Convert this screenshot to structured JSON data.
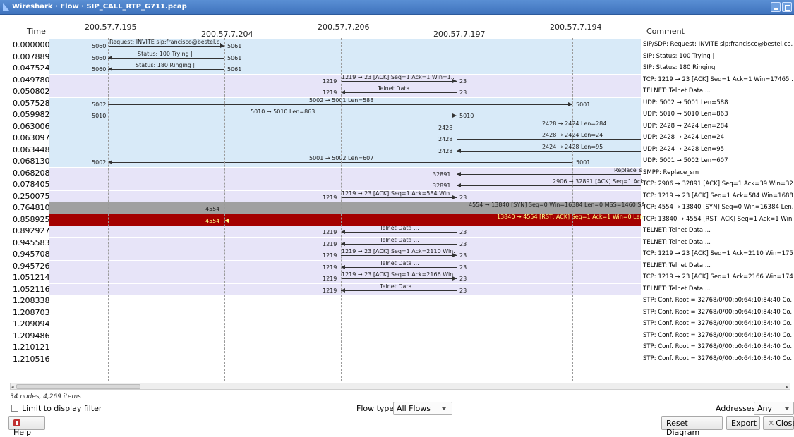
{
  "window": {
    "title": "Wireshark · Flow · SIP_CALL_RTP_G711.pcap"
  },
  "headers": {
    "time": "Time",
    "comment": "Comment"
  },
  "nodes": [
    "200.57.7.195",
    "200.57.7.204",
    "200.57.7.206",
    "200.57.7.197",
    "200.57.7.194"
  ],
  "rows": [
    {
      "time": "0.000000",
      "comment": "SIP/SDP: Request: INVITE sip:francisco@bestel.co...",
      "label": "Request: INVITE sip:francisco@bestel.c...",
      "src_port": "5060",
      "dst_port": "5061",
      "bg": "blue"
    },
    {
      "time": "0.007889",
      "comment": "SIP: Status: 100 Trying |",
      "label": "Status: 100 Trying |",
      "src_port": "5061",
      "dst_port": "5060",
      "bg": "blue"
    },
    {
      "time": "0.047524",
      "comment": "SIP: Status: 180 Ringing |",
      "label": "Status: 180 Ringing |",
      "src_port": "5061",
      "dst_port": "5060",
      "bg": "blue"
    },
    {
      "time": "0.049780",
      "comment": "TCP: 1219 → 23 [ACK] Seq=1 Ack=1 Win=17465 ...",
      "label": "1219 → 23 [ACK] Seq=1 Ack=1 Win=1...",
      "src_port": "1219",
      "dst_port": "23",
      "bg": "purple"
    },
    {
      "time": "0.050802",
      "comment": "TELNET: Telnet Data ...",
      "label": "Telnet Data ...",
      "src_port": "23",
      "dst_port": "1219",
      "bg": "purple"
    },
    {
      "time": "0.057528",
      "comment": "UDP: 5002 → 5001 Len=588",
      "label": "5002 → 5001 Len=588",
      "src_port": "5002",
      "dst_port": "5001",
      "bg": "blue"
    },
    {
      "time": "0.059982",
      "comment": "UDP: 5010 → 5010 Len=863",
      "label": "5010 → 5010 Len=863",
      "src_port": "5010",
      "dst_port": "5010",
      "bg": "blue"
    },
    {
      "time": "0.063006",
      "comment": "UDP: 2428 → 2424 Len=284",
      "label": "2428 → 2424 Len=284",
      "src_port": "2428",
      "dst_port": "",
      "bg": "blue"
    },
    {
      "time": "0.063097",
      "comment": "UDP: 2428 → 2424 Len=24",
      "label": "2428 → 2424 Len=24",
      "src_port": "2428",
      "dst_port": "",
      "bg": "blue"
    },
    {
      "time": "0.063448",
      "comment": "UDP: 2424 → 2428 Len=95",
      "label": "2424 → 2428 Len=95",
      "src_port": "",
      "dst_port": "2428",
      "bg": "blue"
    },
    {
      "time": "0.068130",
      "comment": "UDP: 5001 → 5002 Len=607",
      "label": "5001 → 5002 Len=607",
      "src_port": "5001",
      "dst_port": "5002",
      "bg": "blue"
    },
    {
      "time": "0.068208",
      "comment": "SMPP: Replace_sm",
      "label": "Replace_s",
      "src_port": "",
      "dst_port": "32891",
      "bg": "purple"
    },
    {
      "time": "0.078405",
      "comment": "TCP: 2906 → 32891 [ACK] Seq=1 Ack=39 Win=32...",
      "label": "2906 → 32891 [ACK] Seq=1 Ack",
      "src_port": "",
      "dst_port": "32891",
      "bg": "purple"
    },
    {
      "time": "0.250075",
      "comment": "TCP: 1219 → 23 [ACK] Seq=1 Ack=584 Win=1688...",
      "label": "1219 → 23 [ACK] Seq=1 Ack=584 Win...",
      "src_port": "1219",
      "dst_port": "23",
      "bg": "purple"
    },
    {
      "time": "0.764810",
      "comment": "TCP: 4554 → 13840 [SYN] Seq=0 Win=16384 Len...",
      "label": "4554 → 13840 [SYN] Seq=0 Win=16384 Len=0 MSS=1460 SA",
      "src_port": "4554",
      "dst_port": "",
      "bg": "gray"
    },
    {
      "time": "0.858925",
      "comment": "TCP: 13840 → 4554 [RST, ACK] Seq=1 Ack=1 Win...",
      "label": "13840 → 4554 [RST, ACK] Seq=1 Ack=1 Win=0 Len",
      "src_port": "",
      "dst_port": "4554",
      "bg": "red"
    },
    {
      "time": "0.892927",
      "comment": "TELNET: Telnet Data ...",
      "label": "Telnet Data ...",
      "src_port": "23",
      "dst_port": "1219",
      "bg": "purple"
    },
    {
      "time": "0.945583",
      "comment": "TELNET: Telnet Data ...",
      "label": "Telnet Data ...",
      "src_port": "23",
      "dst_port": "1219",
      "bg": "purple"
    },
    {
      "time": "0.945708",
      "comment": "TCP: 1219 → 23 [ACK] Seq=1 Ack=2110 Win=175...",
      "label": "1219 → 23 [ACK] Seq=1 Ack=2110 Win...",
      "src_port": "1219",
      "dst_port": "23",
      "bg": "purple"
    },
    {
      "time": "0.945726",
      "comment": "TELNET: Telnet Data ...",
      "label": "Telnet Data ...",
      "src_port": "23",
      "dst_port": "1219",
      "bg": "purple"
    },
    {
      "time": "1.051214",
      "comment": "TCP: 1219 → 23 [ACK] Seq=1 Ack=2166 Win=174...",
      "label": "1219 → 23 [ACK] Seq=1 Ack=2166 Win...",
      "src_port": "1219",
      "dst_port": "23",
      "bg": "purple"
    },
    {
      "time": "1.052116",
      "comment": "TELNET: Telnet Data ...",
      "label": "Telnet Data ...",
      "src_port": "23",
      "dst_port": "1219",
      "bg": "purple"
    },
    {
      "time": "1.208338",
      "comment": "STP: Conf. Root = 32768/0/00:b0:64:10:84:40  Co...",
      "label": "",
      "src_port": "",
      "dst_port": "",
      "bg": "none"
    },
    {
      "time": "1.208703",
      "comment": "STP: Conf. Root = 32768/0/00:b0:64:10:84:40  Co...",
      "label": "",
      "src_port": "",
      "dst_port": "",
      "bg": "none"
    },
    {
      "time": "1.209094",
      "comment": "STP: Conf. Root = 32768/0/00:b0:64:10:84:40  Co...",
      "label": "",
      "src_port": "",
      "dst_port": "",
      "bg": "none"
    },
    {
      "time": "1.209486",
      "comment": "STP: Conf. Root = 32768/0/00:b0:64:10:84:40  Co...",
      "label": "",
      "src_port": "",
      "dst_port": "",
      "bg": "none"
    },
    {
      "time": "1.210121",
      "comment": "STP: Conf. Root = 32768/0/00:b0:64:10:84:40  Co...",
      "label": "",
      "src_port": "",
      "dst_port": "",
      "bg": "none"
    },
    {
      "time": "1.210516",
      "comment": "STP: Conf. Root = 32768/0/00:b0:64:10:84:40  Co...",
      "label": "",
      "src_port": "",
      "dst_port": "",
      "bg": "none"
    }
  ],
  "status": "34 nodes, 4,269 items",
  "controls": {
    "limit_label": "Limit to display filter",
    "flow_type_label": "Flow type:",
    "flow_type_value": "All Flows",
    "addresses_label": "Addresses:",
    "addresses_value": "Any"
  },
  "buttons": {
    "help": "Help",
    "reset": "Reset Diagram",
    "export": "Export",
    "close": "Close"
  },
  "colors": {
    "row_blue": "#d8eaf8",
    "row_purple": "#e7e4f8",
    "row_gray": "#a0a0a0",
    "row_red": "#a40000",
    "highlight_text": "#ffff88",
    "titlebar": "#4a80c8"
  }
}
